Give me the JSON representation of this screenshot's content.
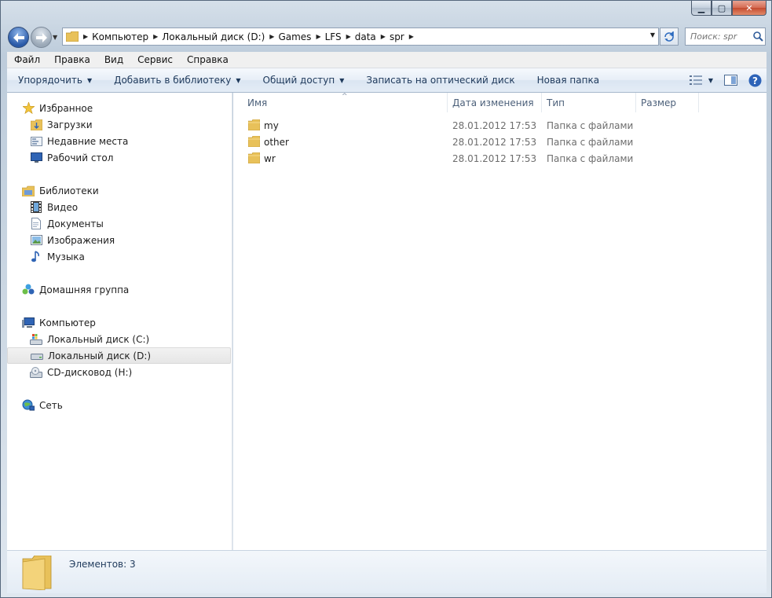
{
  "window": {
    "caption_buttons": {
      "minimize": "▁",
      "maximize": "▢",
      "close": "✕"
    }
  },
  "address_bar": {
    "crumbs": [
      "Компьютер",
      "Локальный диск (D:)",
      "Games",
      "LFS",
      "data",
      "spr"
    ]
  },
  "search": {
    "placeholder": "Поиск: spr"
  },
  "menu": [
    "Файл",
    "Правка",
    "Вид",
    "Сервис",
    "Справка"
  ],
  "toolbar": {
    "organize": "Упорядочить",
    "add_to_library": "Добавить в библиотеку",
    "share": "Общий доступ",
    "burn": "Записать на оптический диск",
    "new_folder": "Новая папка"
  },
  "nav_pane": {
    "favorites": {
      "label": "Избранное",
      "items": [
        "Загрузки",
        "Недавние места",
        "Рабочий стол"
      ]
    },
    "libraries": {
      "label": "Библиотеки",
      "items": [
        "Видео",
        "Документы",
        "Изображения",
        "Музыка"
      ]
    },
    "homegroup": {
      "label": "Домашняя группа"
    },
    "computer": {
      "label": "Компьютер",
      "items": [
        "Локальный диск (C:)",
        "Локальный диск (D:)",
        "CD-дисковод (H:)"
      ]
    },
    "network": {
      "label": "Сеть"
    }
  },
  "columns": {
    "name": "Имя",
    "date": "Дата изменения",
    "type": "Тип",
    "size": "Размер"
  },
  "files": [
    {
      "name": "my",
      "date": "28.01.2012 17:53",
      "type": "Папка с файлами",
      "size": ""
    },
    {
      "name": "other",
      "date": "28.01.2012 17:53",
      "type": "Папка с файлами",
      "size": ""
    },
    {
      "name": "wr",
      "date": "28.01.2012 17:53",
      "type": "Папка с файлами",
      "size": ""
    }
  ],
  "status": {
    "items_count": "Элементов: 3"
  },
  "colors": {
    "accent": "#1e395b",
    "selection": "#e6e6e6",
    "folder": "#e8c15a"
  }
}
